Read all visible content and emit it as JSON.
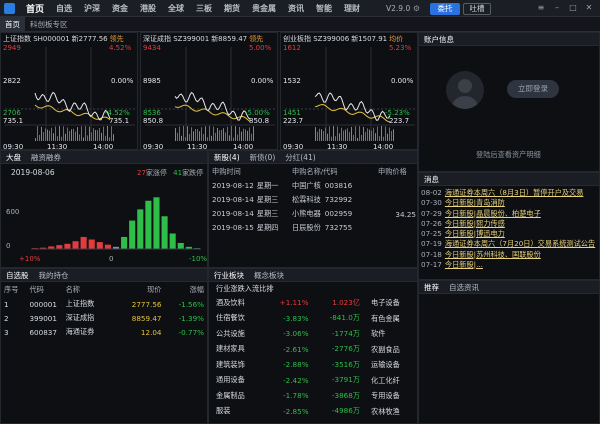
{
  "app": {
    "version": "V2.9.0",
    "entrust_label": "委托",
    "tucao_label": "吐槽"
  },
  "menu": [
    "首页",
    "自选",
    "沪深",
    "资金",
    "港股",
    "全球",
    "三板",
    "期货",
    "贵金属",
    "资讯",
    "智能",
    "理财"
  ],
  "subtabs": [
    "首页",
    "科创板专区"
  ],
  "index_cards": [
    {
      "code_label": "上证指数 SH000001",
      "price": "新2777.56",
      "tail": "领先",
      "top_left": "2949",
      "top_right": "4.52%",
      "mid_left": "2822",
      "mid_right": "0.00%",
      "low_left": "2706",
      "low_right": "-4.52%",
      "vol_left": "735.1",
      "vol_right": "735.1",
      "t0": "09:30",
      "t1": "11:30",
      "t2": "14:00"
    },
    {
      "code_label": "深证成指 SZ399001",
      "price": "新8859.47",
      "tail": "领先",
      "top_left": "9434",
      "top_right": "5.00%",
      "mid_left": "8985",
      "mid_right": "0.00%",
      "low_left": "8536",
      "low_right": "-5.00%",
      "vol_left": "850.8",
      "vol_right": "850.8",
      "t0": "09:30",
      "t1": "11:30",
      "t2": "14:00"
    },
    {
      "code_label": "创业板指 SZ399006",
      "price": "新1507.91",
      "tail": "均价",
      "top_left": "1612",
      "top_right": "5.23%",
      "mid_left": "1532",
      "mid_right": "0.00%",
      "low_left": "1451",
      "low_right": "-5.23%",
      "vol_left": "223.7",
      "vol_right": "223.7",
      "t0": "09:30",
      "t1": "11:30",
      "t2": "14:00"
    }
  ],
  "account": {
    "title": "账户信息",
    "login_label": "立即登录",
    "hint": "登陆后查看资产明细"
  },
  "market": {
    "tabs": [
      "大盘",
      "融资融券"
    ],
    "date": "2019-08-06",
    "rise_count": "27",
    "rise_label": "家涨停",
    "fall_count": "41",
    "fall_label": "家跌停",
    "y_top": "600",
    "y_bottom": "0",
    "x_left": "+10%",
    "x_mid": "0",
    "x_right": "-10%"
  },
  "ipo": {
    "tabs": [
      "新股(4)",
      "新债(0)",
      "分红(41)"
    ],
    "headers": [
      "申购时间",
      "申购名称/代码",
      "申购价格"
    ],
    "rows": [
      [
        "2019-08-12",
        "星期一",
        "中国广核",
        "003816",
        ""
      ],
      [
        "2019-08-14",
        "星期三",
        "松霖科技",
        "732992",
        ""
      ],
      [
        "2019-08-14",
        "星期三",
        "小熊电器",
        "002959",
        "34.25"
      ],
      [
        "2019-08-15",
        "星期四",
        "日辰股份",
        "732755",
        ""
      ]
    ]
  },
  "news": {
    "title": "消息",
    "items": [
      {
        "date": "08-02",
        "text": "海通证券本周六（8月3日）暂停开户及交易"
      },
      {
        "date": "07-30",
        "text": "今日新股|青岛消防"
      },
      {
        "date": "07-29",
        "text": "今日新股|晶晨股份、柏楚电子"
      },
      {
        "date": "07-26",
        "text": "今日新股|熙力传感"
      },
      {
        "date": "07-25",
        "text": "今日新股|博迅电力"
      },
      {
        "date": "07-19",
        "text": "海通证券本周六（7月20日）交易系统测试公告"
      },
      {
        "date": "07-18",
        "text": "今日新股|苏州科技、国联股份"
      },
      {
        "date": "07-17",
        "text": "今日新股|..."
      }
    ]
  },
  "watch": {
    "tabs": [
      "自选股",
      "我的持仓"
    ],
    "headers": [
      "序号",
      "代码",
      "名称",
      "现价",
      "涨幅"
    ],
    "rows": [
      [
        "1",
        "000001",
        "上证指数",
        "2777.56",
        "-1.56%"
      ],
      [
        "2",
        "399001",
        "深证成指",
        "8859.47",
        "-1.39%"
      ],
      [
        "3",
        "600837",
        "海通证券",
        "12.04",
        "-0.77%"
      ]
    ]
  },
  "sectors": {
    "tabs": [
      "行业板块",
      "概念板块"
    ],
    "subtitle": "行业涨跌入流比排",
    "rows": [
      [
        "酒及饮料",
        "+1.11%",
        "1.023亿"
      ],
      [
        "住宿餐饮",
        "-3.83%",
        "-841.0万"
      ],
      [
        "公共设施",
        "-3.06%",
        "-1774万"
      ],
      [
        "建材家具",
        "-2.61%",
        "-2776万"
      ],
      [
        "建筑装饰",
        "-2.88%",
        "-3516万"
      ],
      [
        "通用设备",
        "-2.42%",
        "-3791万"
      ],
      [
        "金属制品",
        "-1.78%",
        "-3868万"
      ],
      [
        "服装",
        "-2.85%",
        "-4986万"
      ]
    ],
    "right_list": [
      "电子设备",
      "有色金属",
      "软件",
      "农副食品",
      "运输设备",
      "化工化纤",
      "专用设备",
      "农林牧渔"
    ]
  },
  "recommend": {
    "tabs": [
      "推荐",
      "自选资讯"
    ]
  },
  "chart_data": {
    "type": "bar",
    "title": "",
    "categories": [
      "+10%",
      "+9%",
      "+8%",
      "+7%",
      "+6%",
      "+5%",
      "+4%",
      "+3%",
      "+2%",
      "+1%",
      "0",
      "-1%",
      "-2%",
      "-3%",
      "-4%",
      "-5%",
      "-6%",
      "-7%",
      "-8%",
      "-9%",
      "-10%"
    ],
    "values": [
      10,
      15,
      30,
      45,
      60,
      90,
      140,
      110,
      80,
      50,
      25,
      140,
      330,
      460,
      560,
      600,
      380,
      180,
      70,
      25,
      10
    ],
    "ylim": [
      0,
      650
    ]
  },
  "colors": {
    "accent": "#2a72e0",
    "up": "#e33c3c",
    "down": "#2fbe4a",
    "price": "#e6c33a"
  }
}
